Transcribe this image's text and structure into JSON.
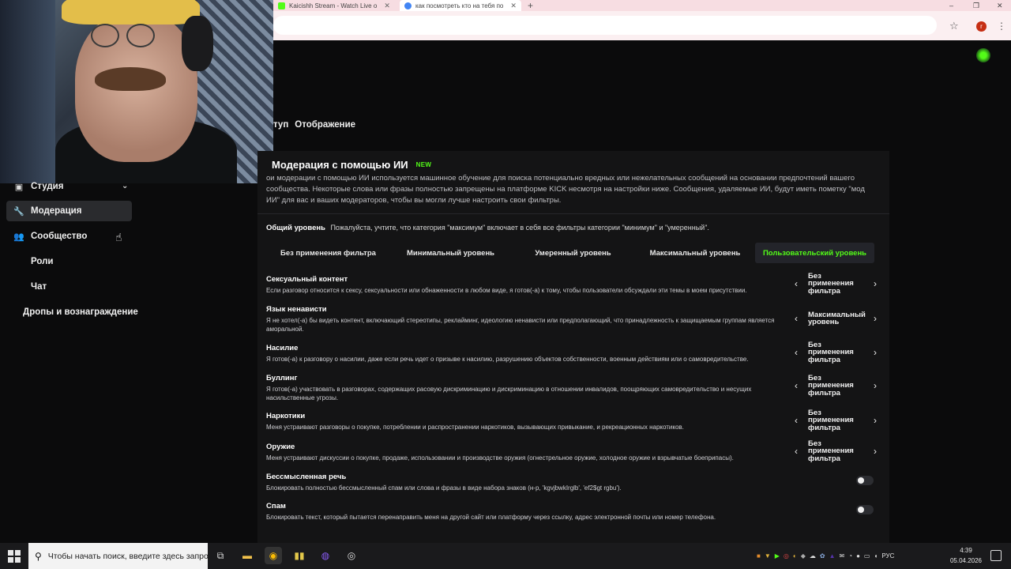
{
  "browser": {
    "tabs": [
      {
        "title": "Kaicishh Stream - Watch Live o",
        "favicon_color": "#53fc18"
      },
      {
        "title": "как посмотреть кто на тебя по",
        "favicon_color": "#4285f4"
      }
    ],
    "new_tab": "+",
    "window_controls": [
      "–",
      "❐",
      "✕"
    ],
    "bookmark_icon": "☆",
    "profile_letter": "r",
    "menu_icon": "⋮"
  },
  "sidebar": {
    "items": [
      {
        "label": "Студия",
        "icon": "▣"
      },
      {
        "label": "Модерация",
        "icon": "🔧"
      },
      {
        "label": "Сообщество",
        "icon": "👥"
      },
      {
        "label": "Роли"
      },
      {
        "label": "Чат"
      },
      {
        "label": "Дропы и вознаграждение"
      }
    ]
  },
  "section_tabs": [
    "туп",
    "Отображение"
  ],
  "moderation": {
    "title": "Модерация с помощью ИИ",
    "badge": "NEW",
    "description": "ои модерации с помощью ИИ используется машинное обучение для поиска потенциально вредных или нежелательных сообщений на основании предпочтений вашего сообщества. Некоторые слова или фразы полностью запрещены на платформе KICK несмотря на настройки ниже. Сообщения, удаляемые ИИ, будут иметь пометку \"мод ИИ\" для вас и ваших модераторов, чтобы вы могли лучше настроить свои фильтры.",
    "general_label": "Общий уровень",
    "general_note": "Пожалуйста, учтите, что категория \"максимум\" включает в себя все фильтры категории \"минимум\" и \"умеренный\".",
    "levels": [
      "Без применения фильтра",
      "Минимальный уровень",
      "Умеренный уровень",
      "Максимальный уровень",
      "Пользовательский уровень"
    ],
    "selected_level": "Пользовательский уровень",
    "rows": [
      {
        "title": "Сексуальный контент",
        "desc": "Если разговор относится к сексу, сексуальности или обнаженности в любом виде, я готов(-а) к тому, чтобы пользователи обсуждали эти темы в моем присутствии.",
        "value": "Без применения фильтра"
      },
      {
        "title": "Язык ненависти",
        "desc": "Я не хотел(-а) бы видеть контент, включающий стереотипы, реклайминг, идеологию ненависти или предполагающий, что принадлежность к защищаемым группам является аморальной.",
        "value": "Максимальный уровень"
      },
      {
        "title": "Насилие",
        "desc": "Я готов(-а) к разговору о насилии, даже если речь идет о призыве к насилию, разрушению объектов собственности, военным действиям или о самовредительстве.",
        "value": "Без применения фильтра"
      },
      {
        "title": "Буллинг",
        "desc": "Я готов(-а) участвовать в разговорах, содержащих расовую дискриминацию и дискриминацию в отношении инвалидов, поощряющих самовредительство и несущих насильственные угрозы.",
        "value": "Без применения фильтра"
      },
      {
        "title": "Наркотики",
        "desc": "Меня устраивают разговоры о покупке, потреблении и распространении наркотиков, вызывающих привыкание, и рекреационных наркотиков.",
        "value": "Без применения фильтра"
      },
      {
        "title": "Оружие",
        "desc": "Меня устраивают дискуссии о покупке, продаже, использовании и производстве оружия (огнестрельное оружие, холодное оружие и взрывчатые боеприпасы).",
        "value": "Без применения фильтра"
      }
    ],
    "toggles": [
      {
        "title": "Бессмысленная речь",
        "desc": "Блокировать полностью бессмысленный спам или слова и фразы в виде набора знаков (н-р, 'kgvjbwkIrglb', 'ef2$gt rgbu').",
        "on": false
      },
      {
        "title": "Спам",
        "desc": "Блокировать текст, который пытается перенаправить меня на другой сайт или платформу через ссылку, адрес электронной почты или номер телефона.",
        "on": false
      }
    ]
  },
  "taskbar": {
    "search_placeholder": "Чтобы начать поиск, введите здесь запрос",
    "language": "РУС",
    "time": "4:39",
    "date": "05.04.2026"
  },
  "colors": {
    "accent": "#53fc18",
    "background": "#0b0b0c",
    "card": "#141415"
  }
}
